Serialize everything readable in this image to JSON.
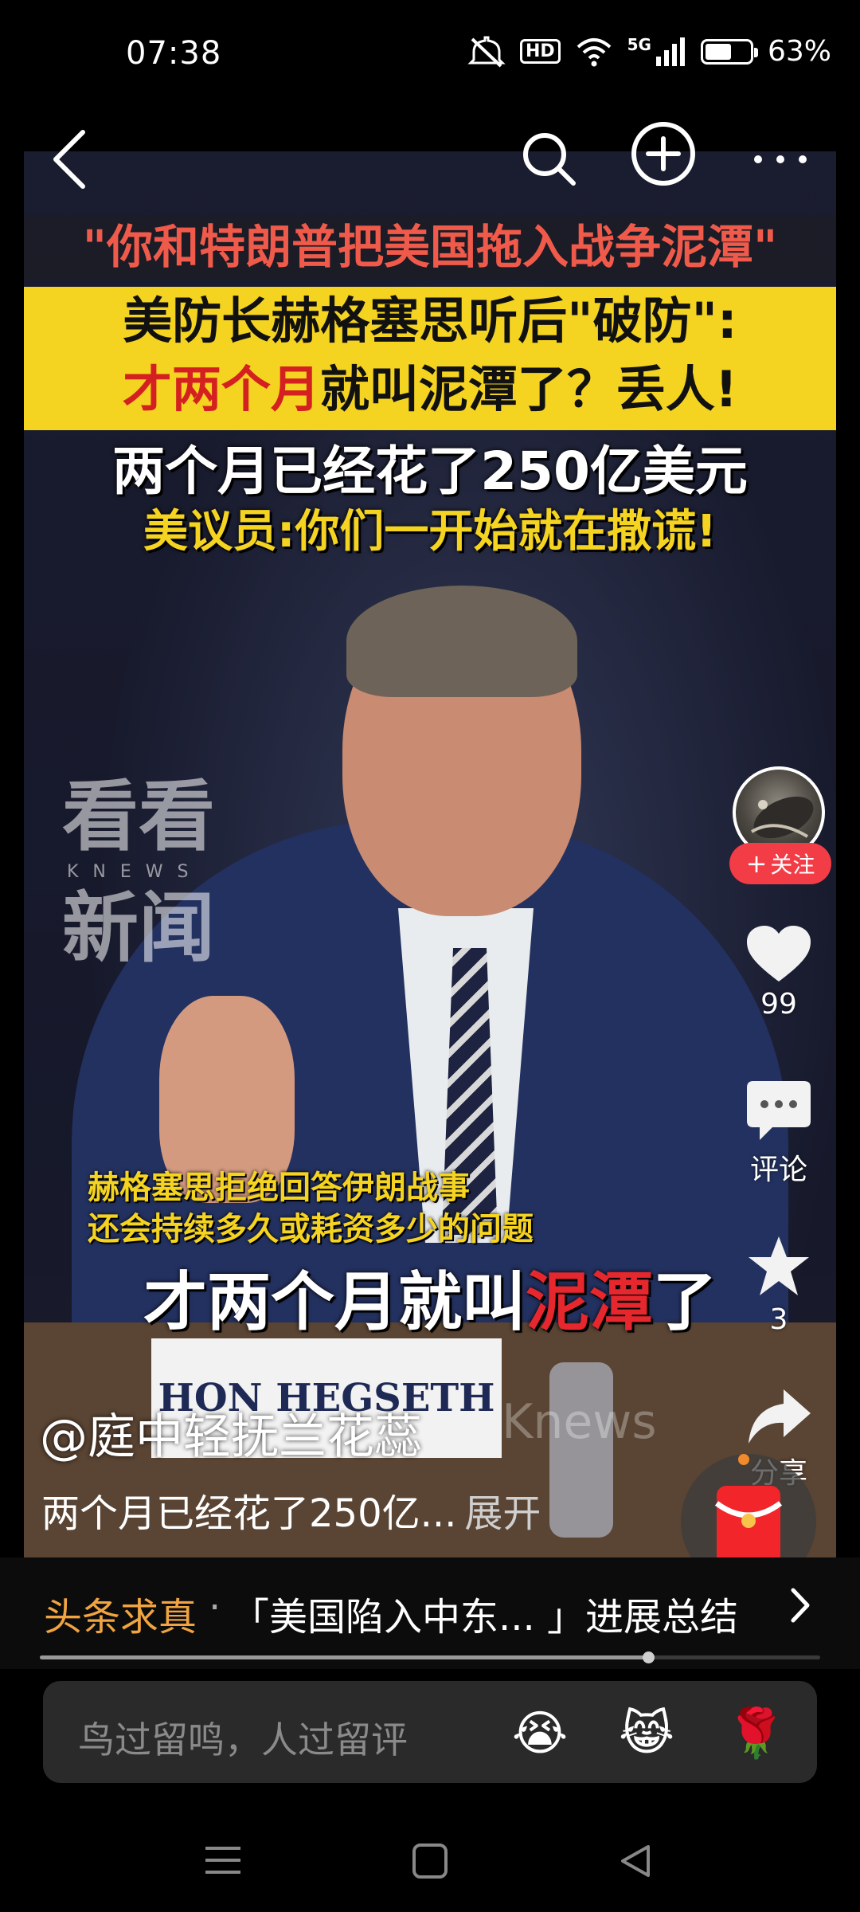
{
  "status_bar": {
    "time": "07:38",
    "hd": "HD",
    "network": "5G",
    "battery_percent": "63%",
    "battery_level": 0.63,
    "icons": [
      "mute-icon",
      "wifi-icon",
      "signal-icon",
      "battery-icon"
    ]
  },
  "video": {
    "quote_banner": "\"你和特朗普把美国拖入战争泥潭\"",
    "yellow_line1": "美防长赫格塞思听后\"破防\":",
    "yellow_line2_red": "才两个月",
    "yellow_line2_rest": "就叫泥潭了？丢人!",
    "white_headline": "两个月已经花了250亿美元",
    "yellow_headline": "美议员:你们一开始就在撒谎!",
    "watermark_top": "看看",
    "watermark_knews": "KNEWS",
    "watermark_bottom": "新闻",
    "caption_line1": "赫格塞思拒绝回答伊朗战事",
    "caption_line2": "还会持续多久或耗资多少的问题",
    "caption_big_white1": "才两个月就叫",
    "caption_big_red": "泥潭",
    "caption_big_white2": "了",
    "nameplate": "HON HEGSETH",
    "overlay_watermark": "Knews"
  },
  "actions": {
    "follow_label": "关注",
    "like_count": "99",
    "comment_label": "评论",
    "favorite_count": "3",
    "share_label": "分享"
  },
  "post": {
    "author": "@庭中轻抚兰花蕊",
    "description": "两个月已经花了250亿...",
    "expand_label": "展开"
  },
  "topic": {
    "label": "头条求真",
    "separator": "·",
    "text": "「美国陷入中东...  」进展总结",
    "progress": 0.78
  },
  "comment_input": {
    "placeholder": "鸟过留鸣，人过留评",
    "emojis": [
      "😭",
      "😹",
      "🌹"
    ]
  },
  "colors": {
    "accent_red": "#f23c46",
    "topic_orange": "#f1a441",
    "banner_yellow": "#f4d321"
  }
}
